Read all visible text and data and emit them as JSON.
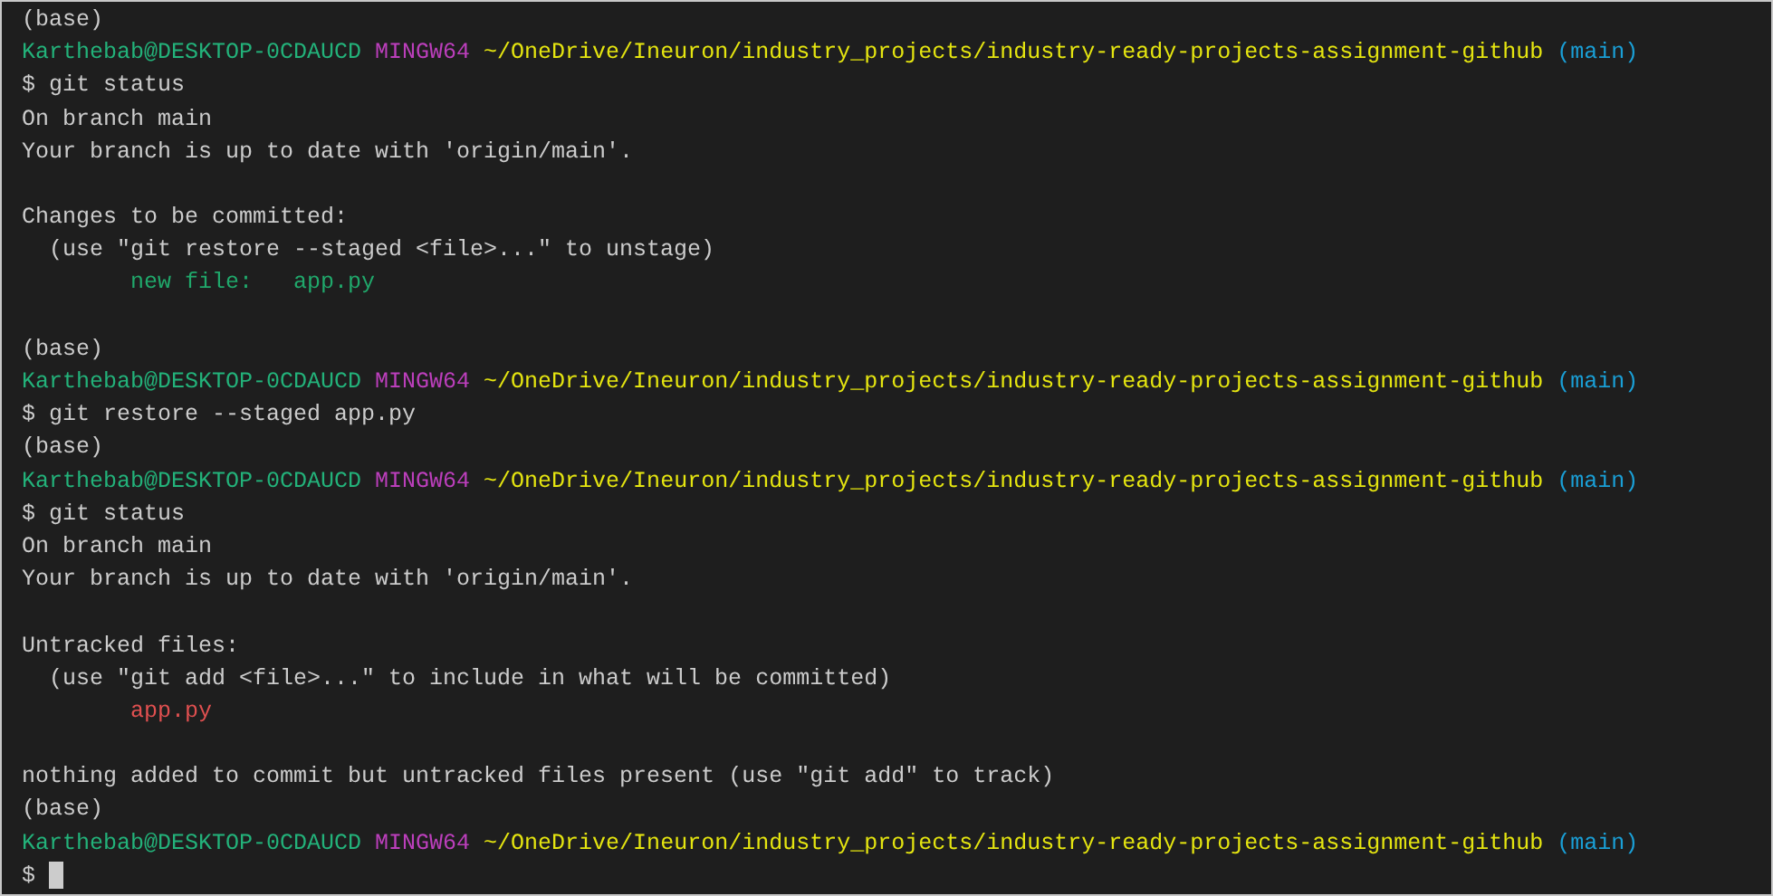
{
  "terminal": {
    "lines": [
      {
        "kind": "output",
        "text": "(base)"
      },
      {
        "kind": "prompt",
        "user": "Karthebab@DESKTOP-0CDAUCD",
        "shell": "MINGW64",
        "path": "~/OneDrive/Ineuron/industry_projects/industry-ready-projects-assignment-github",
        "branch": "(main)"
      },
      {
        "kind": "command",
        "text": "$ git status"
      },
      {
        "kind": "output",
        "text": "On branch main"
      },
      {
        "kind": "output",
        "text": "Your branch is up to date with 'origin/main'."
      },
      {
        "kind": "blank"
      },
      {
        "kind": "output",
        "text": "Changes to be committed:"
      },
      {
        "kind": "hint",
        "text": "(use \"git restore --staged <file>...\" to unstage)"
      },
      {
        "kind": "staged",
        "text": "new file:   app.py"
      },
      {
        "kind": "blank"
      },
      {
        "kind": "output",
        "text": "(base)"
      },
      {
        "kind": "prompt",
        "user": "Karthebab@DESKTOP-0CDAUCD",
        "shell": "MINGW64",
        "path": "~/OneDrive/Ineuron/industry_projects/industry-ready-projects-assignment-github",
        "branch": "(main)"
      },
      {
        "kind": "command",
        "text": "$ git restore --staged app.py"
      },
      {
        "kind": "output",
        "text": "(base)"
      },
      {
        "kind": "prompt",
        "user": "Karthebab@DESKTOP-0CDAUCD",
        "shell": "MINGW64",
        "path": "~/OneDrive/Ineuron/industry_projects/industry-ready-projects-assignment-github",
        "branch": "(main)"
      },
      {
        "kind": "command",
        "text": "$ git status"
      },
      {
        "kind": "output",
        "text": "On branch main"
      },
      {
        "kind": "output",
        "text": "Your branch is up to date with 'origin/main'."
      },
      {
        "kind": "blank"
      },
      {
        "kind": "output",
        "text": "Untracked files:"
      },
      {
        "kind": "hint",
        "text": "(use \"git add <file>...\" to include in what will be committed)"
      },
      {
        "kind": "untracked",
        "text": "app.py"
      },
      {
        "kind": "blank"
      },
      {
        "kind": "output",
        "text": "nothing added to commit but untracked files present (use \"git add\" to track)"
      },
      {
        "kind": "output",
        "text": "(base)"
      },
      {
        "kind": "prompt",
        "user": "Karthebab@DESKTOP-0CDAUCD",
        "shell": "MINGW64",
        "path": "~/OneDrive/Ineuron/industry_projects/industry-ready-projects-assignment-github",
        "branch": "(main)"
      },
      {
        "kind": "input",
        "text": "$"
      }
    ]
  }
}
